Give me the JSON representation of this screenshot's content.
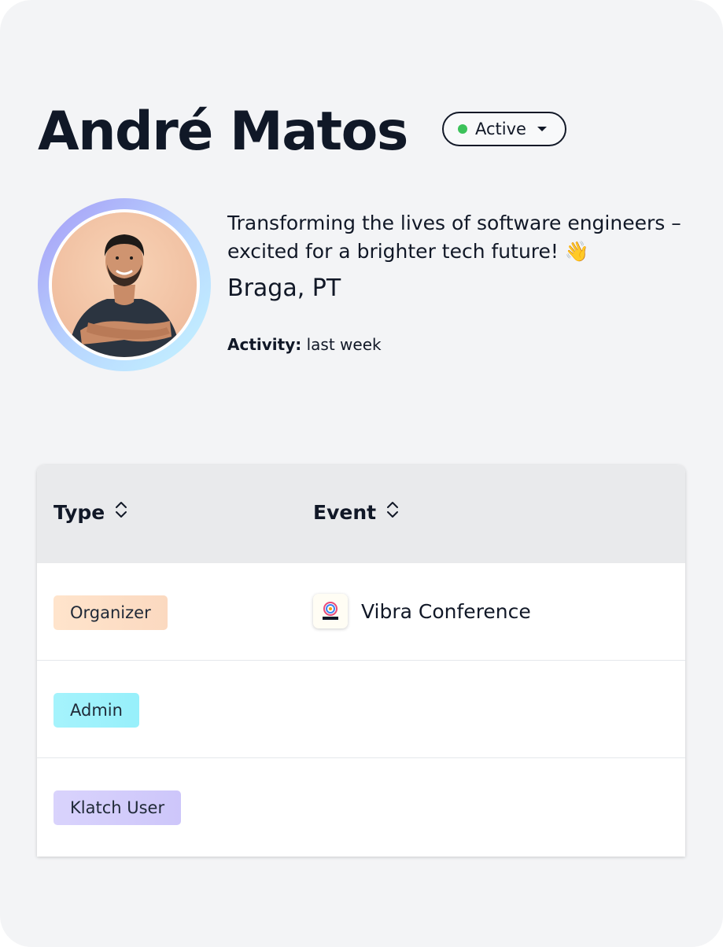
{
  "profile": {
    "name": "André Matos",
    "status": {
      "label": "Active",
      "color": "#3cc25a"
    },
    "avatar_icon": "avatar-photo",
    "bio": "Transforming the lives of software engineers – excited for a brighter tech future! 👋",
    "location": "Braga, PT",
    "activity": {
      "label": "Activity:",
      "value": "last week"
    }
  },
  "table": {
    "columns": [
      {
        "label": "Type",
        "icon": "sort-icon"
      },
      {
        "label": "Event",
        "icon": "sort-icon"
      }
    ],
    "rows": [
      {
        "type": "Organizer",
        "badge_color": "#fde0c7",
        "event": "Vibra Conference",
        "event_icon": "vibra-logo"
      },
      {
        "type": "Admin",
        "badge_color": "#9ef3fb",
        "event": "",
        "event_icon": ""
      },
      {
        "type": "Klatch User",
        "badge_color": "#d3cdfb",
        "event": "",
        "event_icon": ""
      }
    ]
  },
  "colors": {
    "background": "#f3f4f6",
    "text": "#111827",
    "header_bg": "#e9eaec"
  }
}
